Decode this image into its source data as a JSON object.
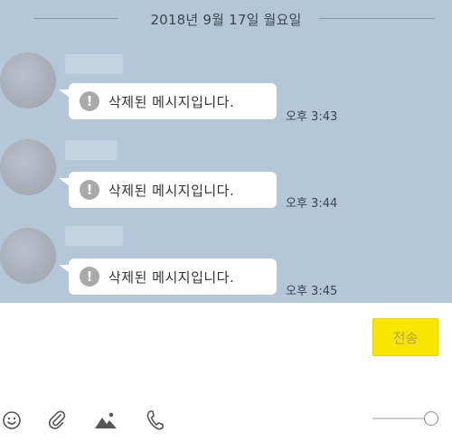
{
  "chat": {
    "date_divider": "2018년 9월 17일 월요일",
    "messages": [
      {
        "text": "삭제된 메시지입니다.",
        "time": "오후 3:43"
      },
      {
        "text": "삭제된 메시지입니다.",
        "time": "오후 3:44"
      },
      {
        "text": "삭제된 메시지입니다.",
        "time": "오후 3:45"
      }
    ],
    "warning_glyph": "!"
  },
  "composer": {
    "send_label": "전송",
    "input_value": ""
  },
  "toolbar": {
    "icons": [
      "emoticon-icon",
      "attachment-icon",
      "image-icon",
      "phone-icon"
    ]
  },
  "colors": {
    "chat_background": "#b3c7d8",
    "send_button": "#f7e600",
    "bubble": "#ffffff"
  }
}
